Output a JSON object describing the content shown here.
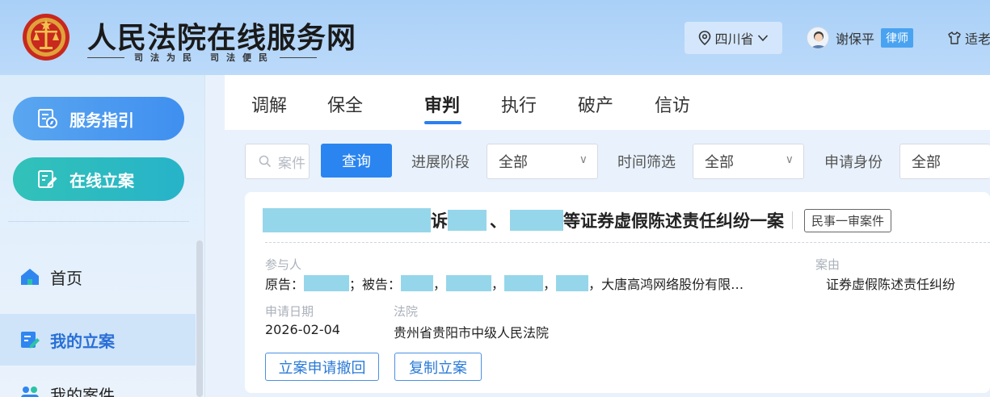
{
  "header": {
    "title": "人民法院在线服务网",
    "slogan_left": "司法为民",
    "slogan_right": "司法便民",
    "region": "四川省",
    "user_name": "谢保平",
    "user_role": "律师",
    "elder_mode": "适老"
  },
  "sidebar": {
    "guide_button": "服务指引",
    "file_button": "在线立案",
    "nav_home": "首页",
    "nav_my_cases": "我的立案",
    "nav_next": "我的案件"
  },
  "tabs": [
    "调解",
    "保全",
    "审判",
    "执行",
    "破产",
    "信访"
  ],
  "active_tab": "审判",
  "filters": {
    "search_placeholder": "案件",
    "query_button": "查询",
    "stage_label": "进展阶段",
    "stage_value": "全部",
    "time_label": "时间筛选",
    "time_value": "全部",
    "identity_label": "申请身份",
    "identity_value": "全部"
  },
  "case": {
    "title_sue": "诉",
    "title_sep": "、",
    "title_rest": "等证券虚假陈述责任纠纷一案",
    "type_badge": "民事一审案件",
    "participants_label": "参与人",
    "plaintiff_prefix": "原告：",
    "defendant_prefix": "；被告：",
    "comma": "，",
    "party_tail": "大唐高鸿网络股份有限…",
    "cause_label": "案由",
    "cause_value": "证券虚假陈述责任纠纷",
    "date_label": "申请日期",
    "date_value": "2026-02-04",
    "court_label": "法院",
    "court_value": "贵州省贵阳市中级人民法院",
    "withdraw_button": "立案申请撤回",
    "copy_button": "复制立案"
  },
  "colors": {
    "header_bg": "#a9d0f7",
    "primary": "#2a85f0",
    "teal": "#27b3c9",
    "redaction": "#96d6ea"
  }
}
